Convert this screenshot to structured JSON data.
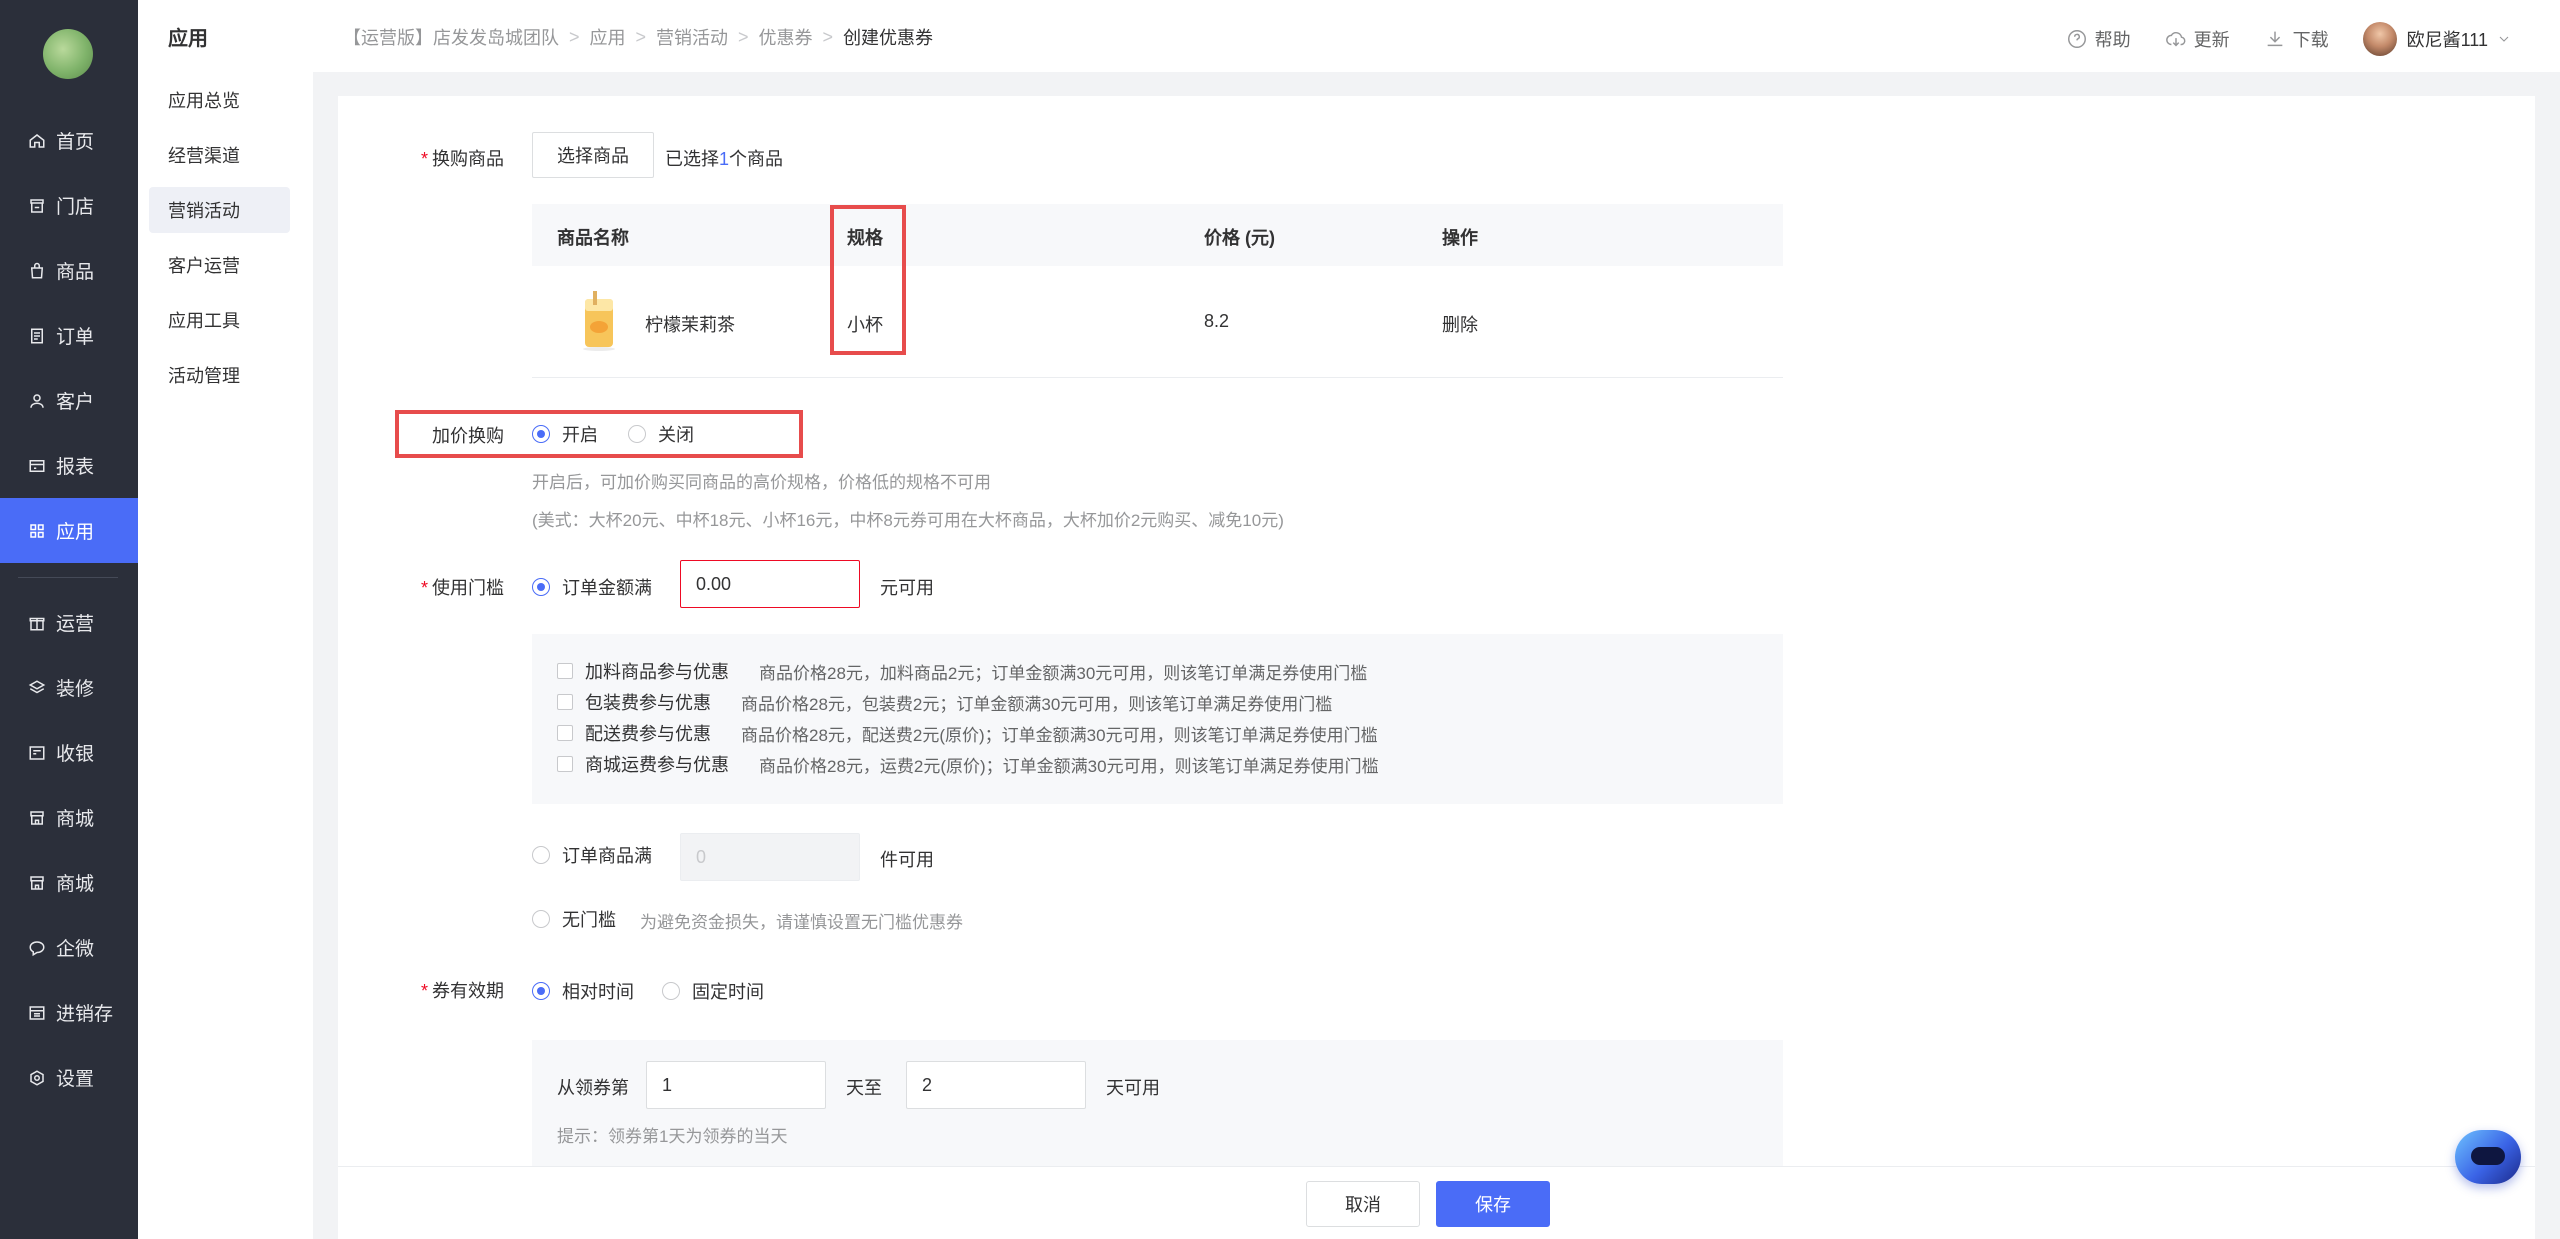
{
  "nav": {
    "items": [
      {
        "label": "首页",
        "icon": "home-icon"
      },
      {
        "label": "门店",
        "icon": "store-icon"
      },
      {
        "label": "商品",
        "icon": "bag-icon"
      },
      {
        "label": "订单",
        "icon": "order-icon"
      },
      {
        "label": "客户",
        "icon": "user-icon"
      },
      {
        "label": "报表",
        "icon": "report-icon"
      },
      {
        "label": "应用",
        "icon": "apps-icon",
        "active": true
      },
      {
        "label": "运营",
        "icon": "gift-icon"
      },
      {
        "label": "装修",
        "icon": "layers-icon"
      },
      {
        "label": "收银",
        "icon": "cashier-icon"
      },
      {
        "label": "商城",
        "icon": "mall-icon"
      },
      {
        "label": "商城",
        "icon": "mall-icon"
      },
      {
        "label": "企微",
        "icon": "chat-icon"
      },
      {
        "label": "进销存",
        "icon": "inventory-icon"
      },
      {
        "label": "设置",
        "icon": "gear-icon"
      }
    ],
    "accent": "#4a6cf7"
  },
  "subnav": {
    "title": "应用",
    "items": [
      "应用总览",
      "经营渠道",
      "营销活动",
      "客户运营",
      "应用工具",
      "活动管理"
    ],
    "active": "营销活动"
  },
  "breadcrumb": [
    "【运营版】店发发岛城团队",
    "应用",
    "营销活动",
    "优惠券",
    "创建优惠券"
  ],
  "tools": {
    "help": "帮助",
    "update": "更新",
    "download": "下载",
    "user": "欧尼酱111"
  },
  "form": {
    "swap_goods": {
      "label": "换购商品",
      "button": "选择商品",
      "selected_prefix": "已选择",
      "selected_count": "1",
      "selected_suffix": "个商品"
    },
    "table": {
      "headers": {
        "name": "商品名称",
        "spec": "规格",
        "price": "价格 (元)",
        "action": "操作"
      },
      "row": {
        "name": "柠檬茉莉茶",
        "spec": "小杯",
        "price": "8.2",
        "action": "删除"
      }
    },
    "addon": {
      "label": "加价换购",
      "on": "开启",
      "off": "关闭",
      "hint1": "开启后，可加价购买同商品的高价规格，价格低的规格不可用",
      "hint2": "(美式：大杯20元、中杯18元、小杯16元，中杯8元券可用在大杯商品，大杯加价2元购买、减免10元)"
    },
    "threshold": {
      "label": "使用门槛",
      "amount_option": "订单金额满",
      "amount_value": "0.00",
      "amount_suffix": "元可用",
      "checks": [
        {
          "name": "加料商品参与优惠",
          "desc": "商品价格28元，加料商品2元；订单金额满30元可用，则该笔订单满足券使用门槛"
        },
        {
          "name": "包装费参与优惠",
          "desc": "商品价格28元，包装费2元；订单金额满30元可用，则该笔订单满足券使用门槛"
        },
        {
          "name": "配送费参与优惠",
          "desc": "商品价格28元，配送费2元(原价)；订单金额满30元可用，则该笔订单满足券使用门槛"
        },
        {
          "name": "商城运费参与优惠",
          "desc": "商品价格28元，运费2元(原价)；订单金额满30元可用，则该笔订单满足券使用门槛"
        }
      ],
      "count_option": "订单商品满",
      "count_placeholder": "0",
      "count_suffix": "件可用",
      "none_option": "无门槛",
      "none_hint": "为避免资金损失，请谨慎设置无门槛优惠券"
    },
    "validity": {
      "label": "券有效期",
      "relative": "相对时间",
      "fixed": "固定时间",
      "from_label": "从领券第",
      "from_value": "1",
      "to_label": "天至",
      "to_value": "2",
      "to_suffix": "天可用",
      "tip": "提示：领券第1天为领券的当天"
    }
  },
  "footer": {
    "cancel": "取消",
    "save": "保存"
  }
}
